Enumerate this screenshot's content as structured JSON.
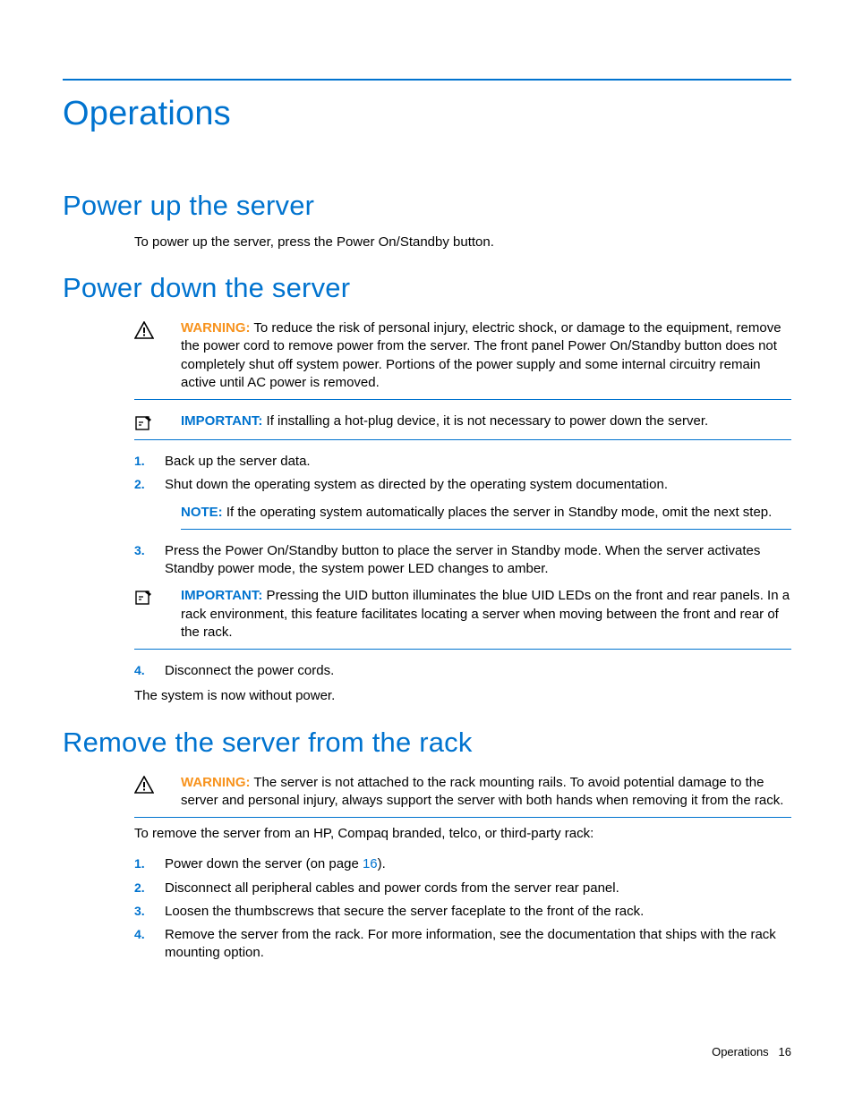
{
  "title": "Operations",
  "footer": {
    "section": "Operations",
    "page": "16"
  },
  "sections": {
    "power_up": {
      "heading": "Power up the server",
      "body": "To power up the server, press the Power On/Standby button."
    },
    "power_down": {
      "heading": "Power down the server",
      "warning": {
        "label": "WARNING:",
        "text": " To reduce the risk of personal injury, electric shock, or damage to the equipment, remove the power cord to remove power from the server. The front panel Power On/Standby button does not completely shut off system power. Portions of the power supply and some internal circuitry remain active until AC power is removed."
      },
      "important1": {
        "label": "IMPORTANT:",
        "text": " If installing a hot-plug device, it is not necessary to power down the server."
      },
      "steps": {
        "s1": "Back up the server data.",
        "s2": "Shut down the operating system as directed by the operating system documentation.",
        "note": {
          "label": "NOTE:",
          "text": " If the operating system automatically places the server in Standby mode, omit the next step."
        },
        "s3": "Press the Power On/Standby button to place the server in Standby mode. When the server activates Standby power mode, the system power LED changes to amber.",
        "important2": {
          "label": "IMPORTANT:",
          "text": " Pressing the UID button illuminates the blue UID LEDs on the front and rear panels. In a rack environment, this feature facilitates locating a server when moving between the front and rear of the rack."
        },
        "s4": "Disconnect the power cords."
      },
      "closing": "The system is now without power."
    },
    "remove_rack": {
      "heading": "Remove the server from the rack",
      "warning": {
        "label": "WARNING:",
        "text": " The server is not attached to the rack mounting rails. To avoid potential damage to the server and personal injury, always support the server with both hands when removing it from the rack."
      },
      "intro": "To remove the server from an HP, Compaq branded, telco, or third-party rack:",
      "steps": {
        "s1a": "Power down the server (on page ",
        "s1link": "16",
        "s1b": ").",
        "s2": "Disconnect all peripheral cables and power cords from the server rear panel.",
        "s3": "Loosen the thumbscrews that secure the server faceplate to the front of the rack.",
        "s4": "Remove the server from the rack. For more information, see the documentation that ships with the rack mounting option."
      }
    }
  }
}
